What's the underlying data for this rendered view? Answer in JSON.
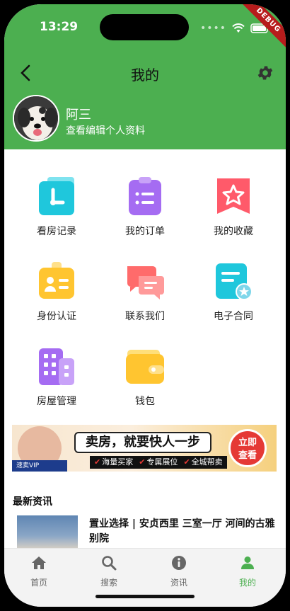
{
  "status_bar": {
    "time": "13:29",
    "debug_label": "DEBUG"
  },
  "app_bar": {
    "title": "我的"
  },
  "profile": {
    "name": "阿三",
    "subtitle": "查看编辑个人资料"
  },
  "menu": [
    {
      "label": "看房记录",
      "icon": "clock-icon",
      "color": "#1fc7dc"
    },
    {
      "label": "我的订单",
      "icon": "clipboard-list-icon",
      "color": "#a56cf2"
    },
    {
      "label": "我的收藏",
      "icon": "star-bookmark-icon",
      "color": "#ff5a6a"
    },
    {
      "label": "身份认证",
      "icon": "id-badge-icon",
      "color": "#ffc530"
    },
    {
      "label": "联系我们",
      "icon": "chat-bubbles-icon",
      "color": "#ff6b6b"
    },
    {
      "label": "电子合同",
      "icon": "contract-document-icon",
      "color": "#1fc7dc"
    },
    {
      "label": "房屋管理",
      "icon": "building-icon",
      "color": "#a56cf2"
    },
    {
      "label": "钱包",
      "icon": "wallet-icon",
      "color": "#ffc530"
    }
  ],
  "banner": {
    "brand_tag": "速卖VIP",
    "headline": "卖房，就要快人一步",
    "tags": [
      "海量买家",
      "专属展位",
      "全城帮卖"
    ],
    "cta_line1": "立即",
    "cta_line2": "查看"
  },
  "news": {
    "section_title": "最新资讯",
    "items": [
      {
        "title": "置业选择 | 安贞西里 三室一厅 河间的古雅别院"
      }
    ]
  },
  "tab_bar": {
    "tabs": [
      {
        "label": "首页",
        "icon": "home-icon"
      },
      {
        "label": "搜索",
        "icon": "search-icon"
      },
      {
        "label": "资讯",
        "icon": "info-icon"
      },
      {
        "label": "我的",
        "icon": "person-icon",
        "active": true
      }
    ]
  },
  "colors": {
    "primary": "#4caf50",
    "tab_inactive": "#666666"
  }
}
